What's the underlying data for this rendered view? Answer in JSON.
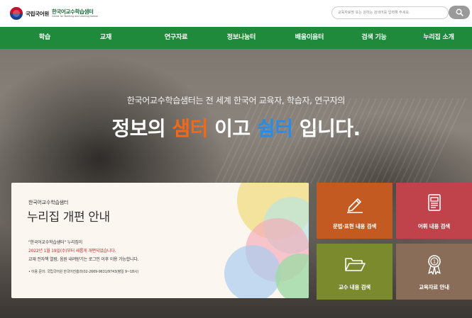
{
  "header": {
    "org_name": "국립국어원",
    "center_name": "한국어교수학습샘터",
    "center_name_en": "Center for Teaching and Learning Korean",
    "search": {
      "placeholder": "교육자료명 또는 원하는 검색어를 입력해 주세요.",
      "button_icon": "search-icon"
    }
  },
  "nav": {
    "items": [
      {
        "label": "학습"
      },
      {
        "label": "교재"
      },
      {
        "label": "연구자료"
      },
      {
        "label": "정보나눔터"
      },
      {
        "label": "배움이음터"
      },
      {
        "label": "검색 기능"
      },
      {
        "label": "누리집 소개"
      }
    ]
  },
  "hero": {
    "line1": "한국어교수학습샘터는 전 세계 한국어 교육자, 학습자, 연구자의",
    "line2": {
      "part1": "정보의 ",
      "highlight1": "샘터",
      "part2": " 이고 ",
      "highlight2": "쉼터",
      "part3": " 입니다."
    }
  },
  "notice": {
    "subtitle": "한국어교수학습샘터",
    "title": "누리집 개편 안내",
    "line1": "\"한국어교수학습샘터\" 누리집이",
    "line2": "2022년 1월 19일(수)부터 새롭게 개편되었습니다.",
    "line3": "교재 전자책 열람, 음원 내려받기는 로그인 이후 이용 가능합니다.",
    "contact": "• 이용 문의: 국립국어원 한국어진흥과(02-2669-9631/9743(평일 9~18시)"
  },
  "tiles": [
    {
      "label": "문법·표현 내용 검색",
      "icon": "pencil-icon",
      "color": "#c25a22"
    },
    {
      "label": "어휘 내용 검색",
      "icon": "document-icon",
      "color": "#c0434c"
    },
    {
      "label": "교수 내용 검색",
      "icon": "folder-icon",
      "color": "#7a8a2c"
    },
    {
      "label": "교육자료 안내",
      "icon": "award-icon",
      "color": "#8a6d58"
    }
  ],
  "colors": {
    "nav_bg": "#1f8a3b",
    "highlight_orange": "#f06a1a",
    "highlight_blue": "#2b8ce8"
  }
}
